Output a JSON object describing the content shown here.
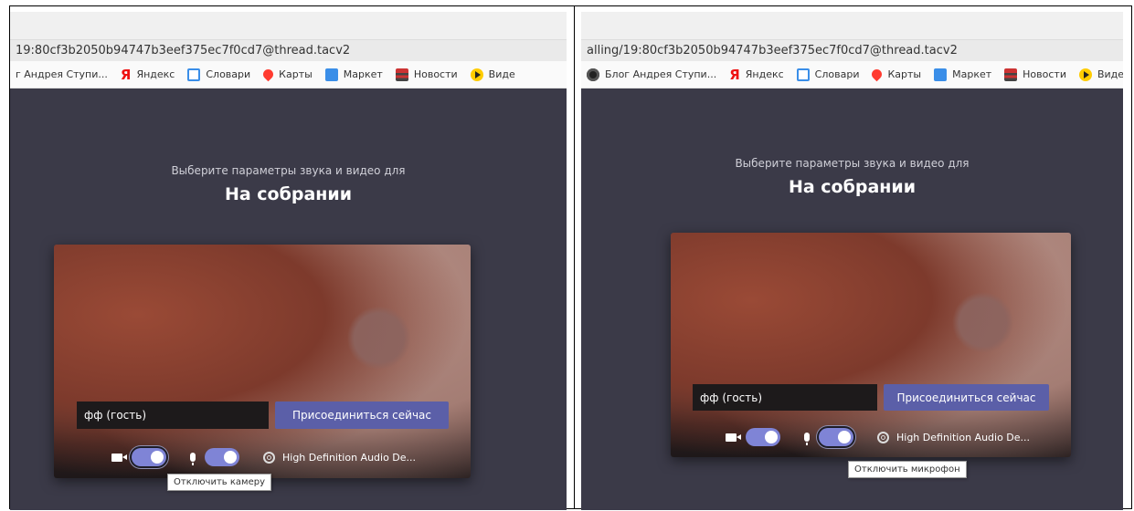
{
  "left": {
    "url": "19:80cf3b2050b94747b3eef375ec7f0cd7@thread.tacv2",
    "bookmarks": [
      {
        "label": "г Андрея Ступи...",
        "icon": "blog-icon"
      },
      {
        "label": "Яндекс",
        "icon": "yandex-icon"
      },
      {
        "label": "Словари",
        "icon": "slovari-icon"
      },
      {
        "label": "Карты",
        "icon": "maps-pin-icon"
      },
      {
        "label": "Маркет",
        "icon": "market-icon"
      },
      {
        "label": "Новости",
        "icon": "news-icon"
      },
      {
        "label": "Виде",
        "icon": "video-icon"
      }
    ],
    "subtitle": "Выберите параметры звука и видео для",
    "title": "На собрании",
    "name_value": "фф (гость)",
    "join_label": "Присоединиться сейчас",
    "device_label": "High Definition Audio De...",
    "tooltip": "Отключить камеру"
  },
  "right": {
    "url": "alling/19:80cf3b2050b94747b3eef375ec7f0cd7@thread.tacv2",
    "bookmarks": [
      {
        "label": "Блог Андрея Ступи...",
        "icon": "blog-icon"
      },
      {
        "label": "Яндекс",
        "icon": "yandex-icon"
      },
      {
        "label": "Словари",
        "icon": "slovari-icon"
      },
      {
        "label": "Карты",
        "icon": "maps-pin-icon"
      },
      {
        "label": "Маркет",
        "icon": "market-icon"
      },
      {
        "label": "Новости",
        "icon": "news-icon"
      },
      {
        "label": "Видео",
        "icon": "video-icon"
      }
    ],
    "subtitle": "Выберите параметры звука и видео для",
    "title": "На собрании",
    "name_value": "фф (гость)",
    "join_label": "Присоединиться сейчас",
    "device_label": "High Definition Audio De...",
    "tooltip": "Отключить микрофон"
  },
  "colors": {
    "teams_bg": "#3b3a48",
    "join_button": "#5b5fa8",
    "toggle_on": "#7f84d6"
  }
}
